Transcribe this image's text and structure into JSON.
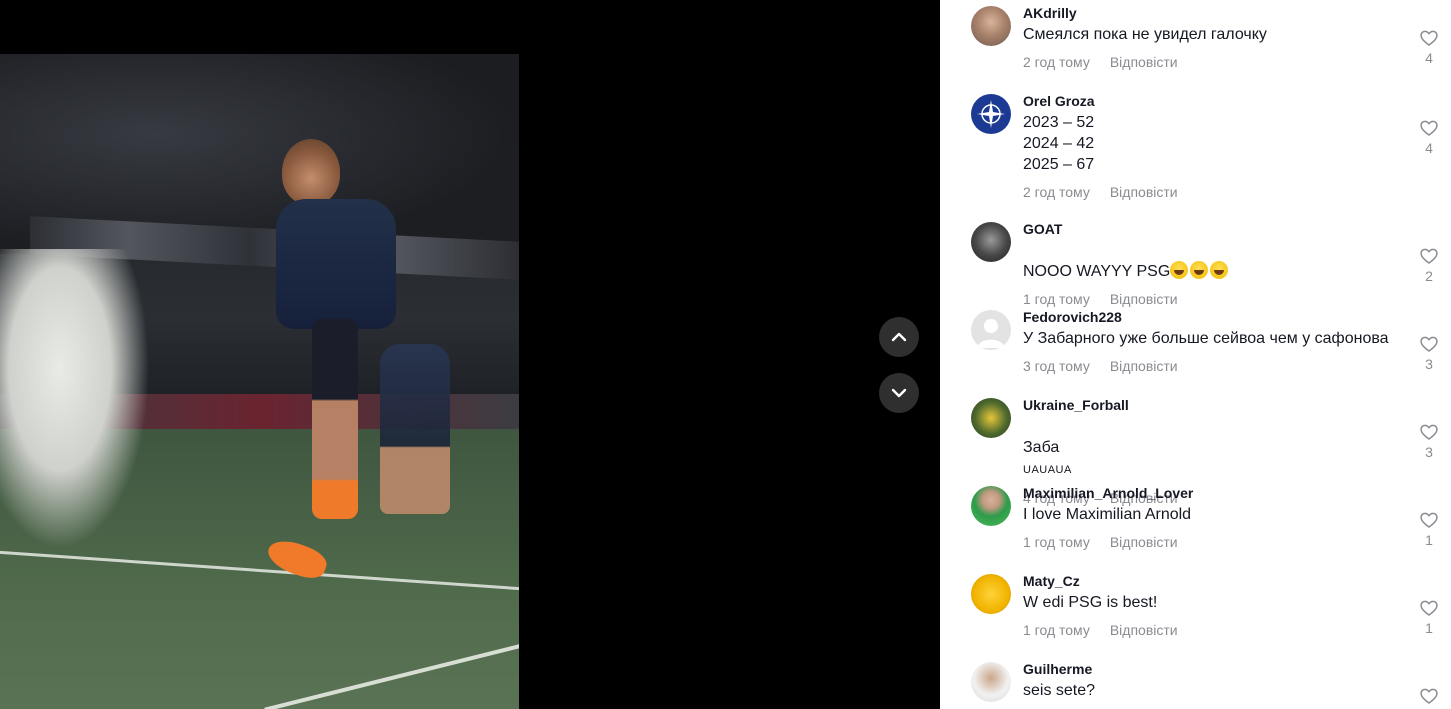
{
  "navigation": {
    "prev_icon": "chevron-up-icon",
    "next_icon": "chevron-down-icon"
  },
  "comments": [
    {
      "username": "AKdrilly",
      "text": "Смеялся пока не увидел галочку",
      "time": "2 год тому",
      "reply": "Відповісти",
      "likes": "4"
    },
    {
      "username": "Orel Groza",
      "text": "2023 – 52\n2024 – 42\n2025 – 67",
      "time": "2 год тому",
      "reply": "Відповісти",
      "likes": "4"
    },
    {
      "username": "GOAT",
      "text": "NOOO WAYYY PSG",
      "time": "1 год тому",
      "reply": "Відповісти",
      "likes": "2"
    },
    {
      "username": "Fedorovich228",
      "text": "У Забарного уже больше сейвоа чем у сафонова",
      "time": "3 год тому",
      "reply": "Відповісти",
      "likes": "3"
    },
    {
      "username": "Ukraine_Forball",
      "text": "Заба",
      "text_extra": "UAUAUA",
      "time": "4 год тому",
      "reply": "Відповісти",
      "likes": "3"
    },
    {
      "username": "Maximilian_Arnold_Lover",
      "text": "I love Maximilian Arnold",
      "time": "1 год тому",
      "reply": "Відповісти",
      "likes": "1"
    },
    {
      "username": "Maty_Cz",
      "text": "W edi PSG is best!",
      "time": "1 год тому",
      "reply": "Відповісти",
      "likes": "1"
    },
    {
      "username": "Guilherme",
      "text": "seis sete?",
      "time": "",
      "reply": "",
      "likes": ""
    }
  ],
  "colors": {
    "text_primary": "#161823",
    "text_secondary": "#8a8b91",
    "nav_button": "#2f2f2f"
  }
}
